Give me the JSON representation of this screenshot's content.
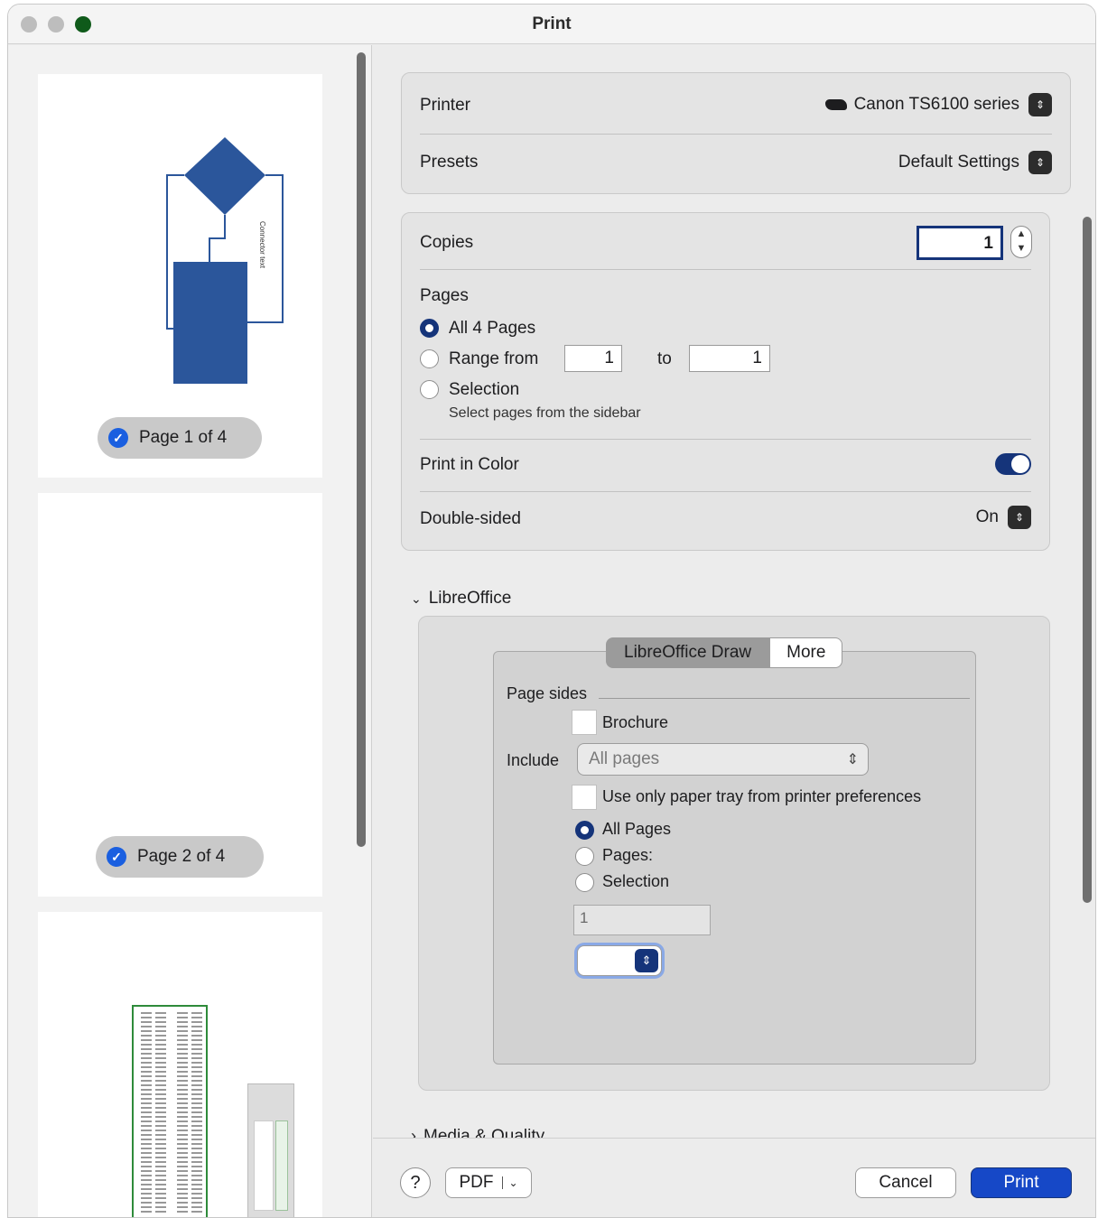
{
  "window": {
    "title": "Print"
  },
  "sidebar": {
    "pages": [
      {
        "label": "Page 1 of 4",
        "selected": true,
        "diagram_text": "Connector text"
      },
      {
        "label": "Page 2 of 4",
        "selected": true
      }
    ]
  },
  "printer": {
    "printer_label": "Printer",
    "printer_value": "Canon TS6100 series",
    "presets_label": "Presets",
    "presets_value": "Default Settings"
  },
  "settings": {
    "copies_label": "Copies",
    "copies_value": "1",
    "pages_label": "Pages",
    "all_pages_label": "All 4 Pages",
    "range_label": "Range from",
    "range_from": "1",
    "range_to_label": "to",
    "range_to": "1",
    "selection_label": "Selection",
    "selection_hint": "Select pages from the sidebar",
    "color_label": "Print in Color",
    "color_on": true,
    "duplex_label": "Double-sided",
    "duplex_value": "On"
  },
  "libreoffice": {
    "section_label": "LibreOffice",
    "tab_draw": "LibreOffice Draw",
    "tab_more": "More",
    "page_sides_label": "Page sides",
    "brochure_label": "Brochure",
    "include_label": "Include",
    "include_value": "All pages",
    "paper_tray_label": "Use only paper tray from printer preferences",
    "all_pages_label": "All Pages",
    "pages_label": "Pages:",
    "selection_label": "Selection",
    "pages_input": "1"
  },
  "media_quality_label": "Media & Quality",
  "footer": {
    "help_label": "?",
    "pdf_label": "PDF",
    "cancel_label": "Cancel",
    "print_label": "Print"
  },
  "colors": {
    "accent": "#15347a",
    "print_button": "#1648c7",
    "diagram_blue": "#2b569b",
    "checkmark": "#1a5fe0"
  }
}
